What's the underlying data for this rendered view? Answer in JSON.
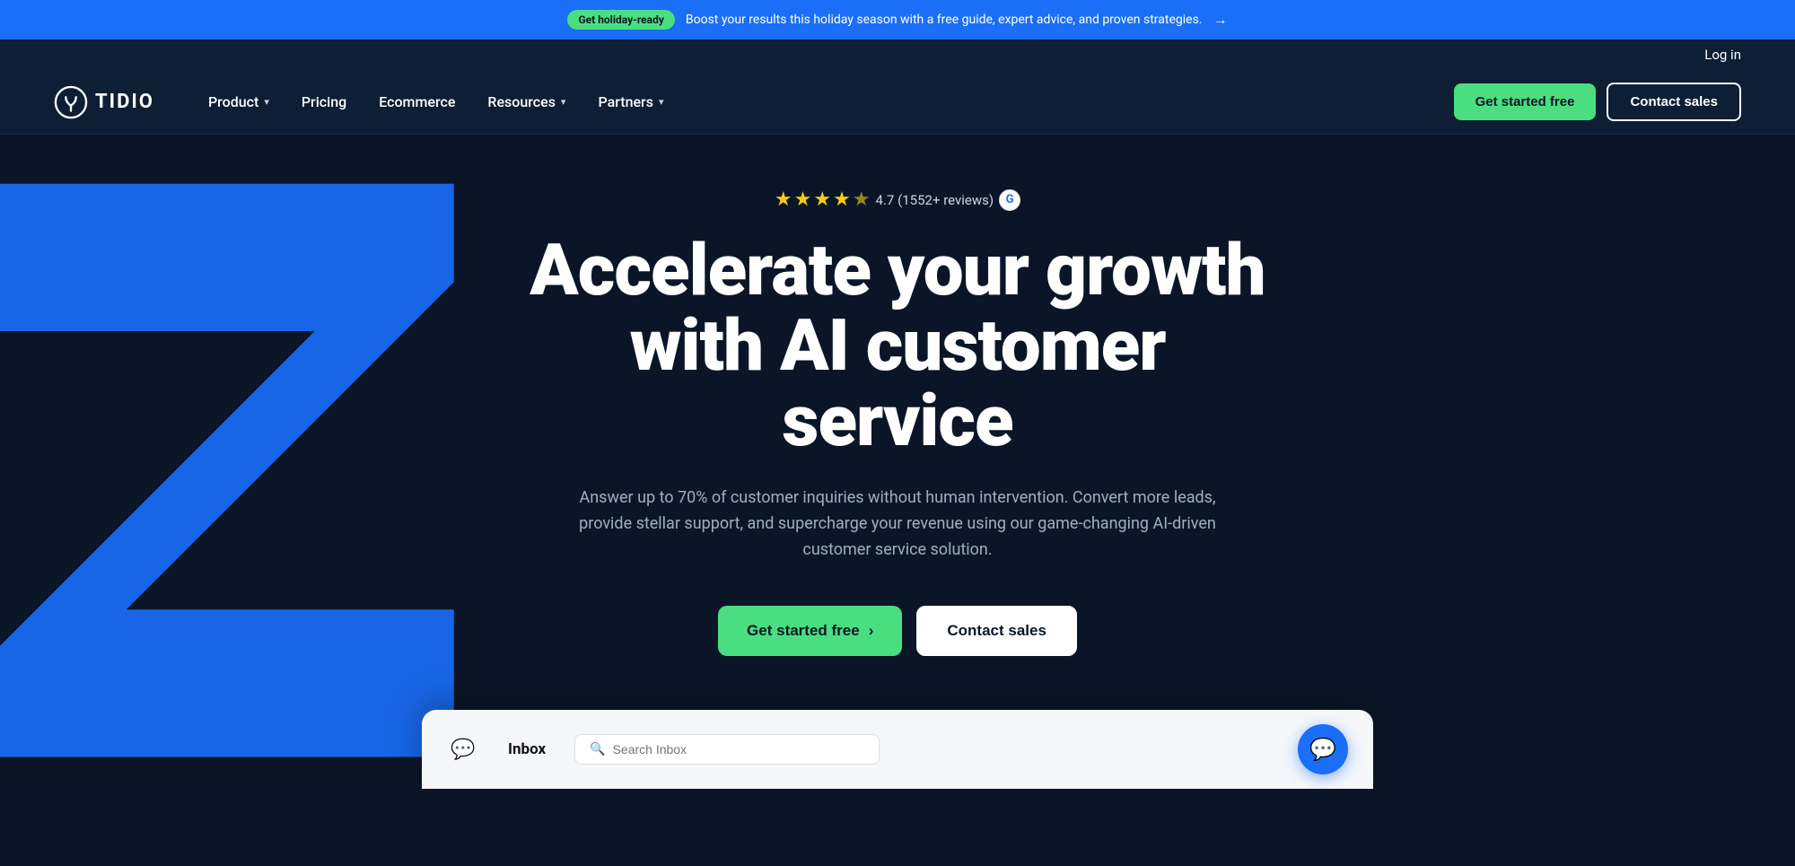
{
  "banner": {
    "badge": "Get holiday-ready",
    "text": "Boost your results this holiday season with a free guide, expert advice, and proven strategies.",
    "arrow": "→"
  },
  "loginBar": {
    "loginLabel": "Log in"
  },
  "nav": {
    "logoText": "TIDIO",
    "items": [
      {
        "label": "Product",
        "hasDropdown": true
      },
      {
        "label": "Pricing",
        "hasDropdown": false
      },
      {
        "label": "Ecommerce",
        "hasDropdown": false
      },
      {
        "label": "Resources",
        "hasDropdown": true
      },
      {
        "label": "Partners",
        "hasDropdown": true
      }
    ],
    "getStartedLabel": "Get started free",
    "contactSalesLabel": "Contact sales"
  },
  "hero": {
    "rating": {
      "value": "4.7",
      "reviews": "(1552+ reviews)"
    },
    "title": "Accelerate your growth\nwith AI customer service",
    "subtitle": "Answer up to 70% of customer inquiries without human intervention. Convert more leads, provide stellar support, and supercharge your revenue using our game-changing AI-driven customer service solution.",
    "getStartedLabel": "Get started free",
    "contactSalesLabel": "Contact sales"
  },
  "inbox": {
    "label": "Inbox",
    "searchPlaceholder": "Search Inbox"
  },
  "colors": {
    "accent": "#4ade80",
    "brand": "#1a6ef7",
    "dark": "#0a1628"
  }
}
